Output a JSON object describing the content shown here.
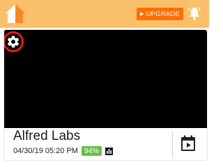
{
  "header": {
    "home_icon": "home-icon",
    "upgrade_label": "UPGRADE",
    "upgrade_icon": "play-arrow-icon",
    "bell_icon": "bell-icon",
    "colors": {
      "header_bg": "#f9c069",
      "upgrade_bg": "#ff6f00"
    }
  },
  "camera": {
    "name": "Alfred Labs",
    "timestamp": "04/30/19 05:20 PM",
    "battery": "94%",
    "settings_icon": "gear-icon",
    "stats_icon": "bar-chart-icon",
    "events_icon": "calendar-play-icon",
    "colors": {
      "battery_bg": "#6dbd4a",
      "highlight": "#e31b1b"
    }
  }
}
